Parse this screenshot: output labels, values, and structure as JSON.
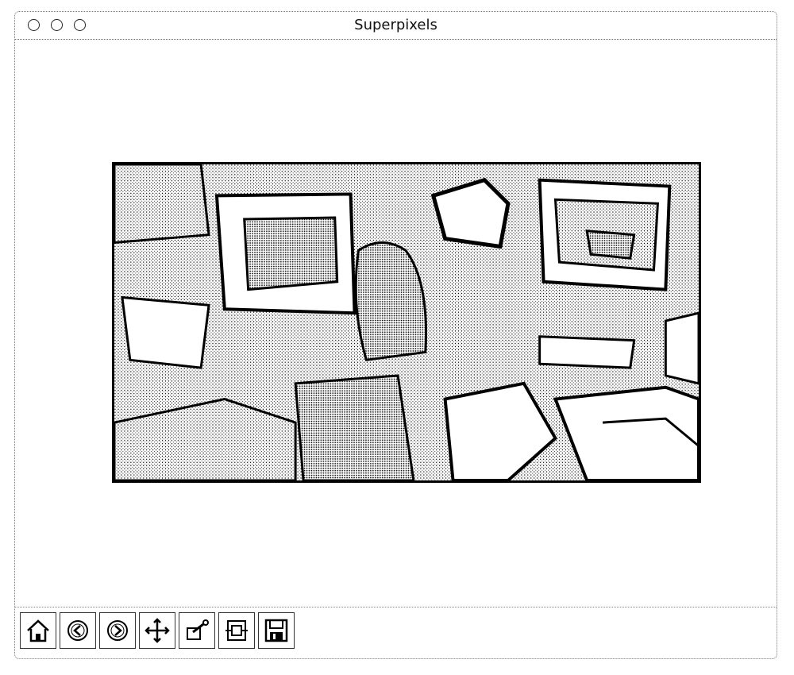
{
  "window": {
    "title": "Superpixels"
  },
  "toolbar": {
    "buttons": [
      {
        "name": "home-icon"
      },
      {
        "name": "back-icon"
      },
      {
        "name": "forward-icon"
      },
      {
        "name": "pan-icon"
      },
      {
        "name": "zoom-icon"
      },
      {
        "name": "subplots-icon"
      },
      {
        "name": "save-icon"
      }
    ]
  },
  "colors": {
    "background": "#ffffff",
    "stroke": "#000000"
  }
}
